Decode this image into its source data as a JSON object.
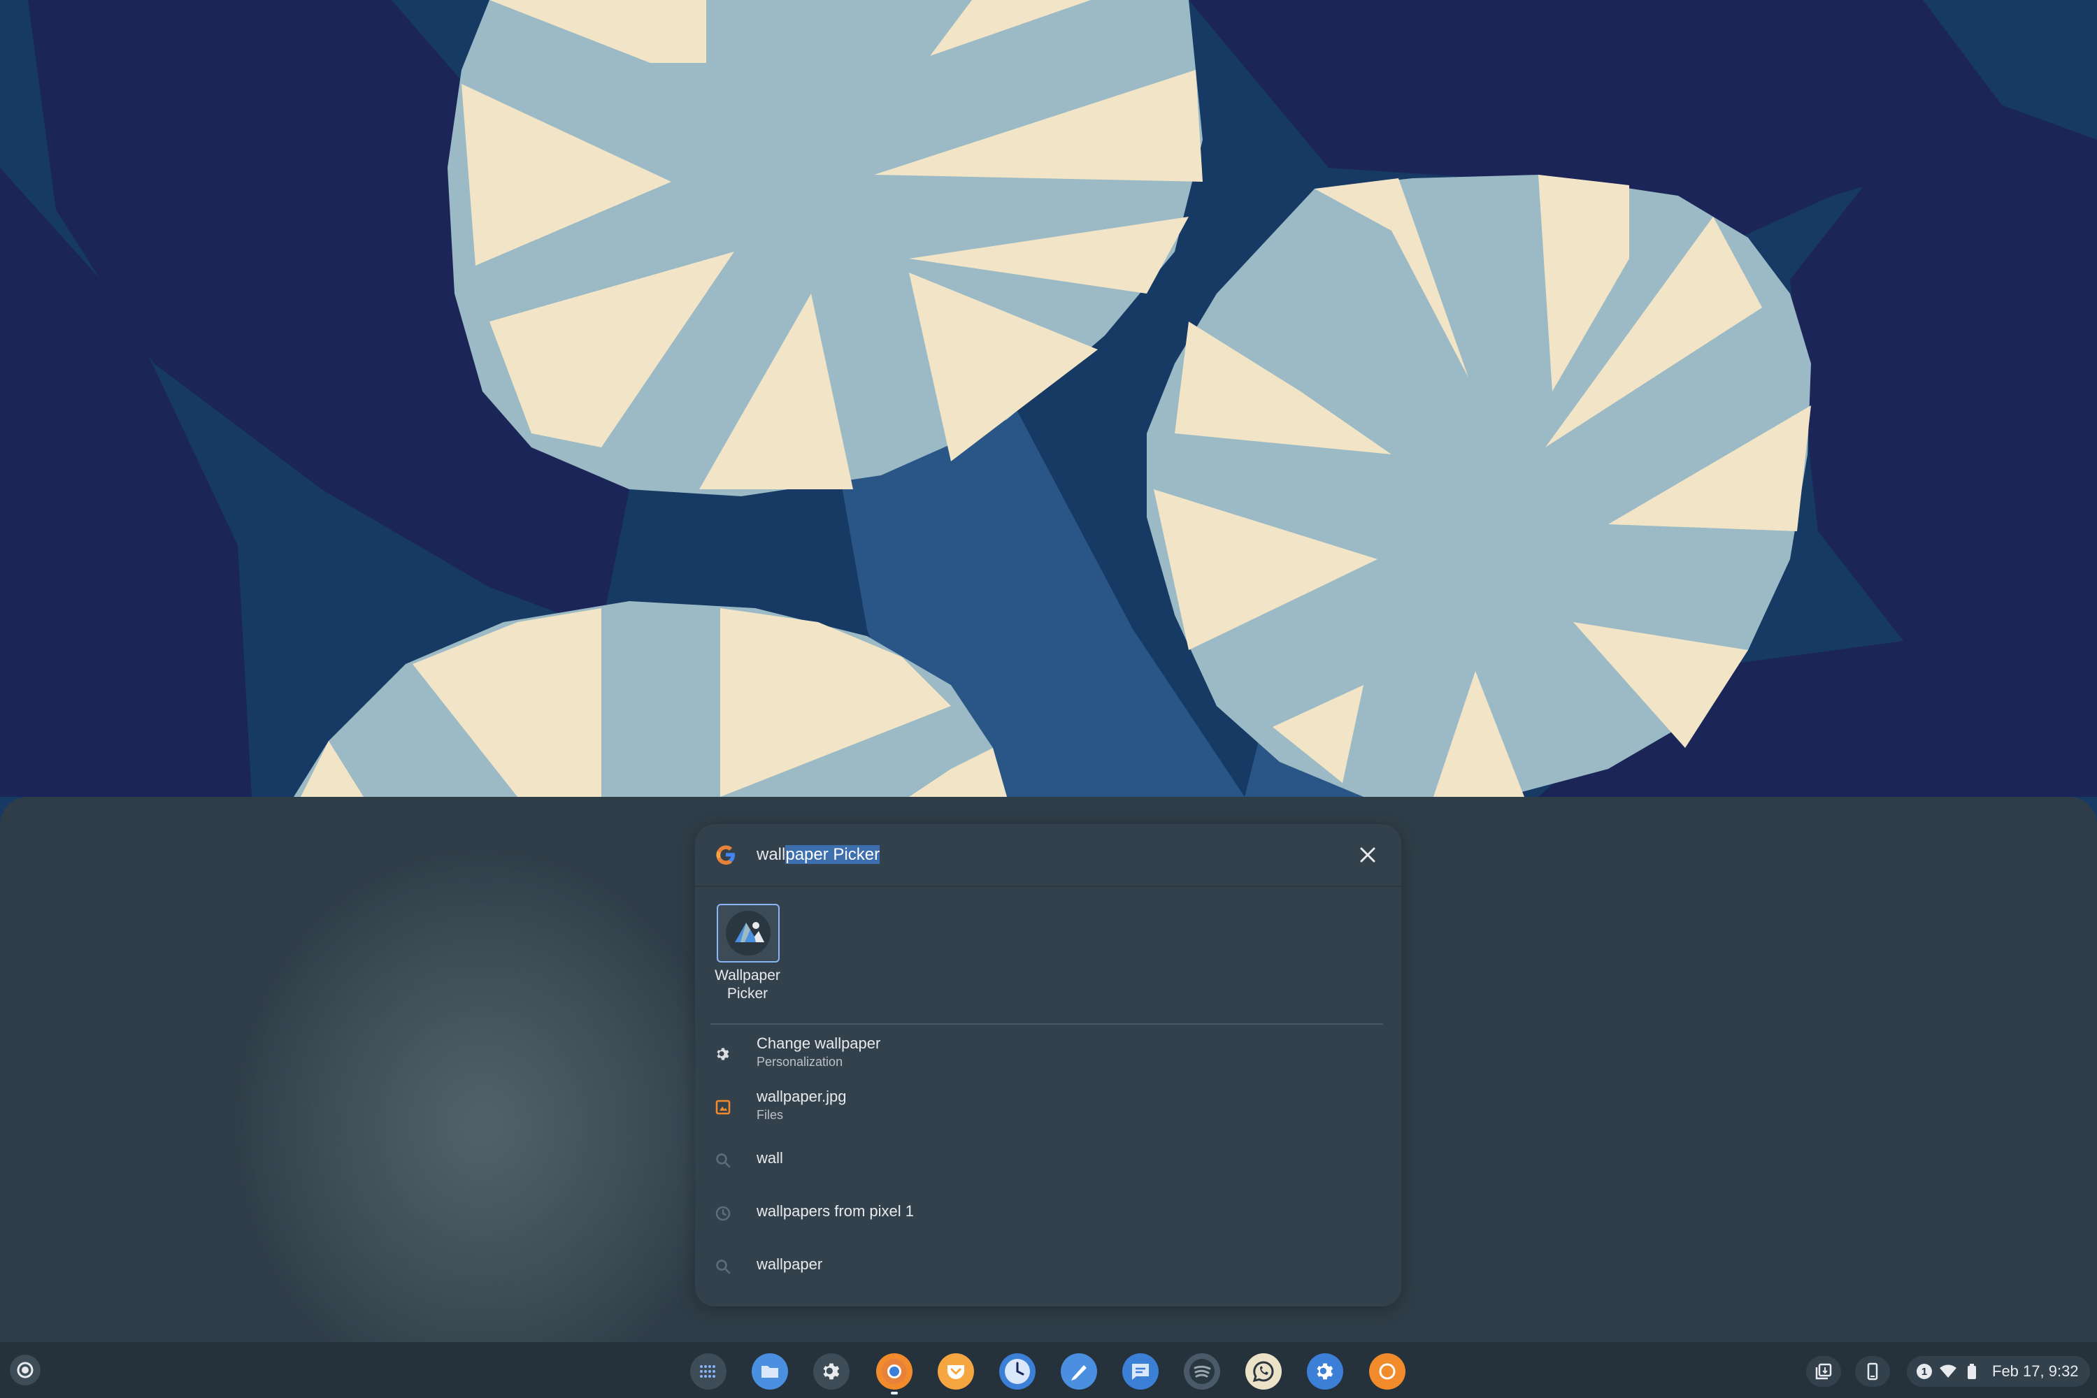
{
  "search": {
    "query_typed": "wall",
    "query_autocomplete": "paper Picker"
  },
  "best_match": {
    "label": "Wallpaper Picker"
  },
  "results": [
    {
      "title": "Change wallpaper",
      "subtitle": "Personalization",
      "icon": "settings-gear-icon"
    },
    {
      "title": "wallpaper.jpg",
      "subtitle": "Files",
      "icon": "image-file-icon"
    },
    {
      "title": "wall",
      "subtitle": "",
      "icon": "search-icon"
    },
    {
      "title": "wallpapers from pixel 1",
      "subtitle": "",
      "icon": "history-clock-icon"
    },
    {
      "title": "wallpaper",
      "subtitle": "",
      "icon": "search-icon"
    }
  ],
  "shelf": {
    "apps": [
      {
        "name": "app-launcher-grid",
        "color": "#3e4c57"
      },
      {
        "name": "files",
        "color": "#4a8fe0"
      },
      {
        "name": "settings",
        "color": "#3e4c57"
      },
      {
        "name": "chrome",
        "color": "#f28b2c"
      },
      {
        "name": "pocket",
        "color": "#f6a640"
      },
      {
        "name": "clock",
        "color": "#3c7fd6"
      },
      {
        "name": "google-keep-canvas",
        "color": "#4a8fe0"
      },
      {
        "name": "messages",
        "color": "#3c7fd6"
      },
      {
        "name": "spotify",
        "color": "#4a5a68"
      },
      {
        "name": "whatsapp",
        "color": "#ece2c8"
      },
      {
        "name": "chrome-settings",
        "color": "#3c7fd6"
      },
      {
        "name": "orange-circle-app",
        "color": "#f28b2c"
      }
    ],
    "notification_count": "1",
    "clock": "Feb 17, 9:32"
  },
  "colors": {
    "launcher_bg": "#2f3d48",
    "panel_bg": "#33414d",
    "selection": "#3d6fae",
    "wallpaper_deep": "#1c2557",
    "wallpaper_mid": "#163a63",
    "wallpaper_blue": "#2a5587",
    "flower_blue": "#9bbac5",
    "flower_cream": "#f2e5c7"
  }
}
